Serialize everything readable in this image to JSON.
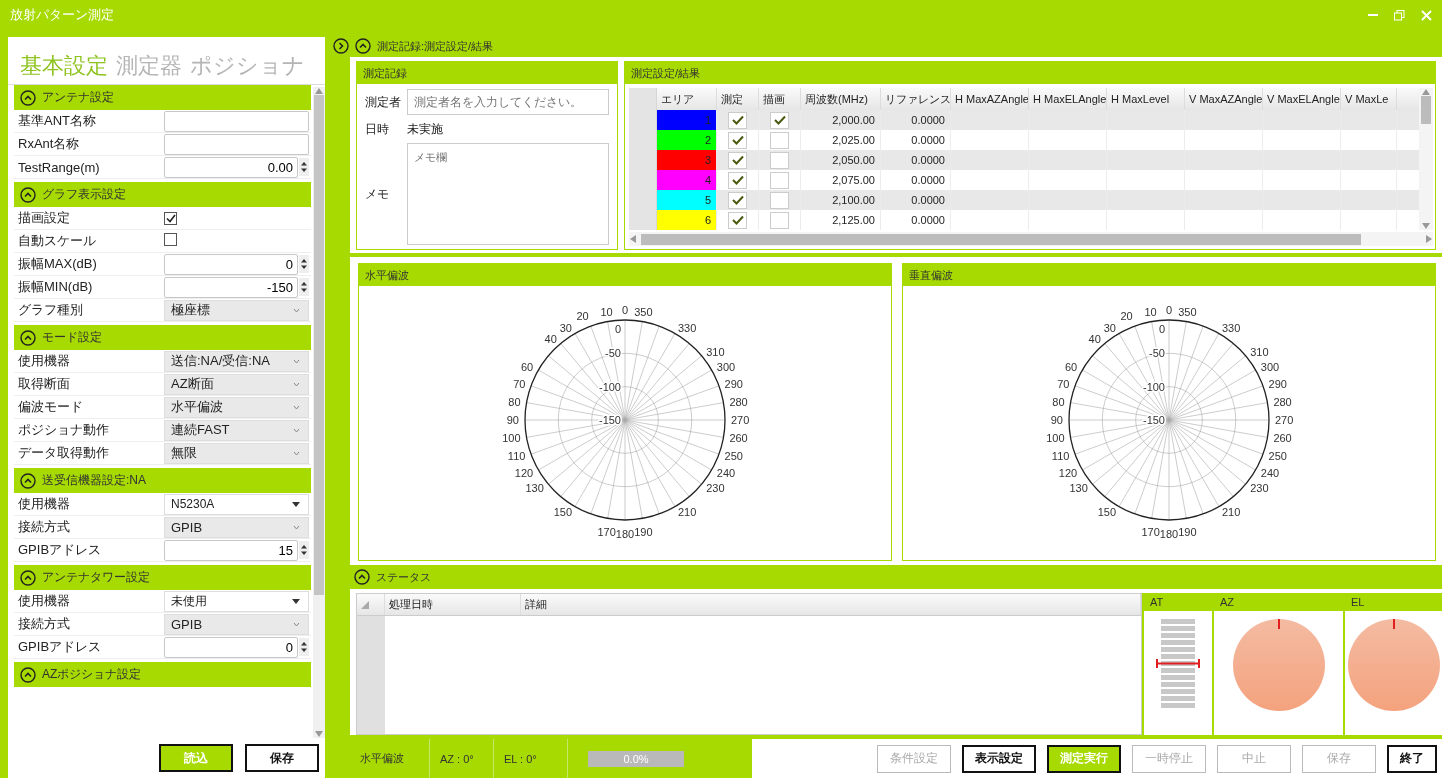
{
  "window": {
    "title": "放射パターン測定"
  },
  "left_panel": {
    "tabs": [
      {
        "label": "基本設定",
        "selected": true
      },
      {
        "label": "測定器",
        "selected": false
      },
      {
        "label": "ポジショナ",
        "selected": false
      }
    ],
    "sections": [
      {
        "title": "アンテナ設定",
        "expanded": true,
        "rows": [
          {
            "label": "基準ANT名称",
            "kind": "text"
          },
          {
            "label": "RxAnt名称",
            "kind": "text"
          },
          {
            "label": "TestRange(m)",
            "kind": "spin",
            "value": "0.00"
          }
        ]
      },
      {
        "title": "グラフ表示設定",
        "expanded": true,
        "rows": [
          {
            "label": "描画設定",
            "kind": "checkbox",
            "checked": true
          },
          {
            "label": "自動スケール",
            "kind": "checkbox",
            "checked": false
          },
          {
            "label": "振幅MAX(dB)",
            "kind": "spin",
            "value": "0"
          },
          {
            "label": "振幅MIN(dB)",
            "kind": "spin",
            "value": "-150"
          },
          {
            "label": "グラフ種別",
            "kind": "select",
            "value": "極座標"
          }
        ]
      },
      {
        "title": "モード設定",
        "expanded": true,
        "rows": [
          {
            "label": "使用機器",
            "kind": "select",
            "value": "送信:NA/受信:NA"
          },
          {
            "label": "取得断面",
            "kind": "select",
            "value": "AZ断面"
          },
          {
            "label": "偏波モード",
            "kind": "select",
            "value": "水平偏波"
          },
          {
            "label": "ポジショナ動作",
            "kind": "select",
            "value": "連続FAST"
          },
          {
            "label": "データ取得動作",
            "kind": "select",
            "value": "無限"
          }
        ]
      },
      {
        "title": "送受信機器設定:NA",
        "expanded": true,
        "rows": [
          {
            "label": "使用機器",
            "kind": "combo",
            "value": "N5230A"
          },
          {
            "label": "接続方式",
            "kind": "select",
            "value": "GPIB"
          },
          {
            "label": "GPIBアドレス",
            "kind": "spin",
            "value": "15"
          }
        ]
      },
      {
        "title": "アンテナタワー設定",
        "expanded": true,
        "rows": [
          {
            "label": "使用機器",
            "kind": "combo",
            "value": "未使用"
          },
          {
            "label": "接続方式",
            "kind": "select",
            "value": "GPIB"
          },
          {
            "label": "GPIBアドレス",
            "kind": "spin",
            "value": "0"
          }
        ]
      },
      {
        "title": "AZポジショナ設定",
        "expanded": true
      }
    ],
    "buttons": [
      {
        "label": "読込",
        "kind": "primary"
      },
      {
        "label": "保存",
        "kind": "plain"
      }
    ]
  },
  "main": {
    "title": "測定記録:測定設定/結果",
    "record": {
      "title": "測定記録",
      "operator_label": "測定者",
      "operator_placeholder": "測定者名を入力してください。",
      "date_label": "日時",
      "date_value": "未実施",
      "memo_label": "メモ",
      "memo_placeholder": "メモ欄"
    },
    "results": {
      "title": "測定設定/結果",
      "columns": [
        "エリア",
        "測定",
        "描画",
        "周波数(MHz)",
        "リファレンス",
        "H MaxAZAngle",
        "H MaxELAngle",
        "H MaxLevel",
        "V MaxAZAngle",
        "V MaxELAngle",
        "V MaxLe"
      ],
      "rows": [
        {
          "area": "1",
          "color": "#0000ff",
          "measure": true,
          "draw": true,
          "frequency": "2,000.00",
          "reference": "0.0000"
        },
        {
          "area": "2",
          "color": "#00ff00",
          "measure": true,
          "draw": false,
          "frequency": "2,025.00",
          "reference": "0.0000"
        },
        {
          "area": "3",
          "color": "#ff0000",
          "measure": true,
          "draw": false,
          "frequency": "2,050.00",
          "reference": "0.0000"
        },
        {
          "area": "4",
          "color": "#ff00ff",
          "measure": true,
          "draw": false,
          "frequency": "2,075.00",
          "reference": "0.0000"
        },
        {
          "area": "5",
          "color": "#00ffff",
          "measure": true,
          "draw": false,
          "frequency": "2,100.00",
          "reference": "0.0000"
        },
        {
          "area": "6",
          "color": "#ffff00",
          "measure": true,
          "draw": false,
          "frequency": "2,125.00",
          "reference": "0.0000"
        }
      ]
    }
  },
  "charts": [
    {
      "title": "水平偏波",
      "angle_labels": [
        "20",
        "10",
        "0",
        "350",
        "30",
        "330",
        "40",
        "310",
        "60",
        "300",
        "70",
        "290",
        "80",
        "280",
        "90",
        "270",
        "100",
        "260",
        "110",
        "250",
        "120",
        "240",
        "130",
        "230",
        "150",
        "210",
        "170",
        "180",
        "190"
      ],
      "radial_labels": [
        "0",
        "-50",
        "-100",
        "-150"
      ]
    },
    {
      "title": "垂直偏波",
      "angle_labels": [
        "20",
        "10",
        "0",
        "350",
        "30",
        "330",
        "40",
        "310",
        "60",
        "300",
        "70",
        "290",
        "80",
        "280",
        "90",
        "270",
        "100",
        "260",
        "110",
        "250",
        "120",
        "240",
        "130",
        "230",
        "150",
        "210",
        "170",
        "180",
        "190"
      ],
      "radial_labels": [
        "0",
        "-50",
        "-100",
        "-150"
      ]
    }
  ],
  "status": {
    "title": "ステータス",
    "columns": [
      "処理日時",
      "詳細"
    ],
    "indicators": [
      {
        "label": "AT",
        "kind": "tower"
      },
      {
        "label": "AZ",
        "kind": "dial"
      },
      {
        "label": "EL",
        "kind": "dial"
      }
    ]
  },
  "status_bar": {
    "polarization": "水平偏波",
    "az": "AZ : 0°",
    "el": "EL : 0°",
    "progress": {
      "level": 0,
      "reading": "0.0%"
    }
  },
  "actions": [
    {
      "label": "条件設定",
      "kind": "plain",
      "disabled": true
    },
    {
      "label": "表示設定",
      "kind": "plain",
      "disabled": false
    },
    {
      "label": "測定実行",
      "kind": "primary",
      "disabled": false
    },
    {
      "label": "一時停止",
      "kind": "plain",
      "disabled": true
    },
    {
      "label": "中止",
      "kind": "plain",
      "disabled": true
    },
    {
      "label": "保存",
      "kind": "plain",
      "disabled": true
    },
    {
      "label": "終了",
      "kind": "plain",
      "disabled": false
    }
  ]
}
